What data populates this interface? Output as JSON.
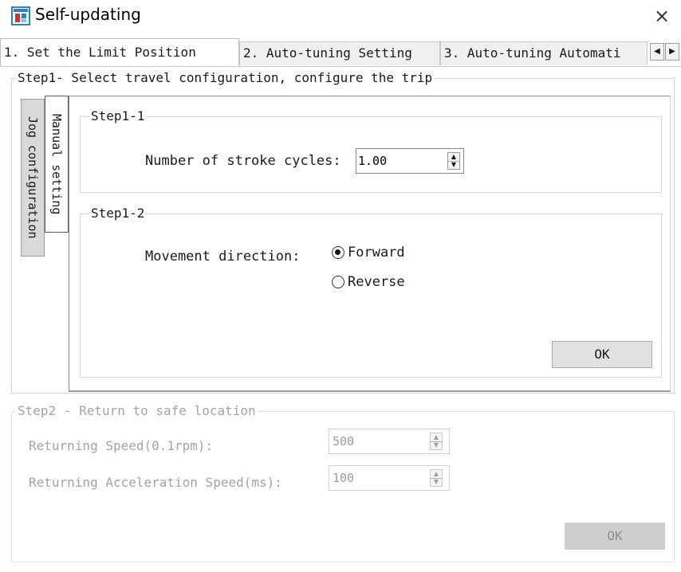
{
  "window": {
    "title": "Self-updating",
    "close_glyph": "×",
    "icon": "app-icon"
  },
  "tabs": [
    {
      "label": "1. Set the Limit Position",
      "active": true
    },
    {
      "label": "2. Auto-tuning Setting",
      "active": false
    },
    {
      "label": "3. Auto-tuning Automati",
      "active": false
    }
  ],
  "tab_scroll": {
    "left_glyph": "◀",
    "right_glyph": "▶"
  },
  "step1": {
    "title": "Step1- Select travel configuration, configure the trip",
    "vtabs": {
      "jog": "Jog configuration",
      "manual": "Manual setting"
    },
    "step1_1": {
      "title": "Step1-1",
      "stroke_label": "Number of stroke cycles:",
      "stroke_value": "1.00"
    },
    "step1_2": {
      "title": "Step1-2",
      "direction_label": "Movement direction:",
      "forward_label": "Forward",
      "reverse_label": "Reverse",
      "selected": "forward"
    },
    "ok_label": "OK"
  },
  "step2": {
    "title": "Step2 - Return to safe location",
    "speed_label": "Returning Speed(0.1rpm):",
    "speed_value": "500",
    "accel_label": "Returning Acceleration Speed(ms):",
    "accel_value": "100",
    "ok_label": "OK",
    "enabled": false
  },
  "colors": {
    "accent_icon": "#2c7fd1",
    "disabled_text": "#a3a3a3"
  }
}
